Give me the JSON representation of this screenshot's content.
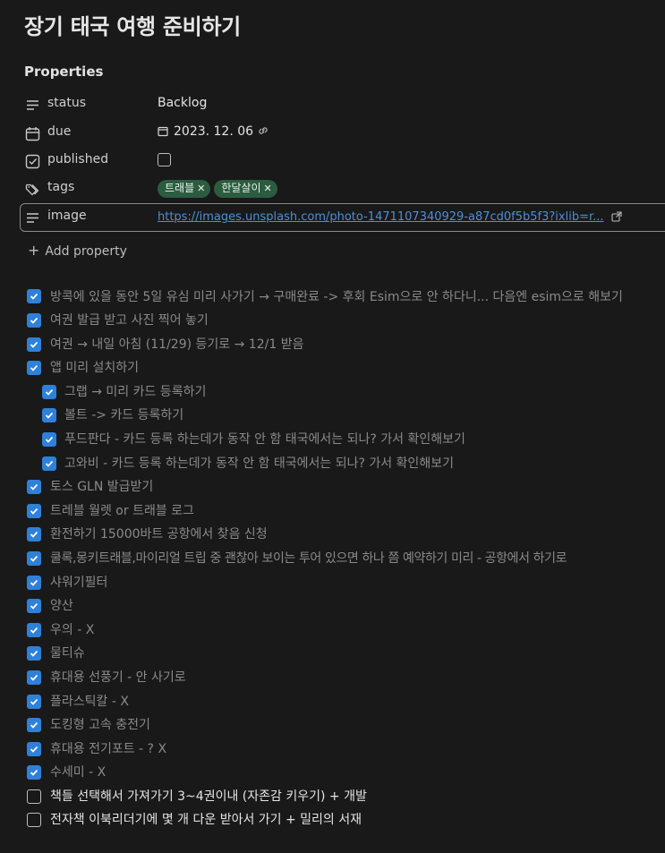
{
  "page": {
    "title": "장기 태국 여행 준비하기",
    "properties_heading": "Properties"
  },
  "properties": {
    "status": {
      "name": "status",
      "value": "Backlog"
    },
    "due": {
      "name": "due",
      "value": "2023. 12. 06"
    },
    "published": {
      "name": "published",
      "checked": false
    },
    "tags": {
      "name": "tags",
      "items": [
        "트래블",
        "한달살이"
      ],
      "color": "#2b5c3f"
    },
    "image": {
      "name": "image",
      "value": "https://images.unsplash.com/photo-1471107340929-a87cd0f5b5f3?ixlib=r..."
    },
    "add_property_label": "Add property"
  },
  "checklist": [
    {
      "text": "방콕에 있을 동안 5일 유심 미리 사가기 → 구매완료 -> 후회 Esim으로 안 하다니... 다음엔 esim으로 해보기",
      "checked": true,
      "indent": 0
    },
    {
      "text": "여권 발급 받고 사진 찍어 놓기",
      "checked": true,
      "indent": 0
    },
    {
      "text": "여권 → 내일 아침 (11/29) 등기로 → 12/1 받음",
      "checked": true,
      "indent": 0
    },
    {
      "text": "앱 미리 설치하기",
      "checked": true,
      "indent": 0
    },
    {
      "text": "그랩 → 미리 카드 등록하기",
      "checked": true,
      "indent": 1
    },
    {
      "text": "볼트 -> 카드 등록하기",
      "checked": true,
      "indent": 1
    },
    {
      "text": "푸드판다 - 카드 등록 하는데가 동작 안 함 태국에서는 되나? 가서 확인해보기",
      "checked": true,
      "indent": 1
    },
    {
      "text": "고와비 - 카드 등록 하는데가 동작 안 함 태국에서는 되나? 가서 확인해보기",
      "checked": true,
      "indent": 1
    },
    {
      "text": "토스 GLN 발급받기",
      "checked": true,
      "indent": 0
    },
    {
      "text": "트레블 월렛 or 트래블 로그",
      "checked": true,
      "indent": 0
    },
    {
      "text": "환전하기 15000바트 공항에서 찾음 신청",
      "checked": true,
      "indent": 0
    },
    {
      "text": "쿨록,몽키트래블,마이리얼 트립 중 괜찮아 보이는 투어 있으면 하나 쯤 예약하기 미리 - 공항에서 하기로",
      "checked": true,
      "indent": 0
    },
    {
      "text": "샤워기필터",
      "checked": true,
      "indent": 0
    },
    {
      "text": "양산",
      "checked": true,
      "indent": 0
    },
    {
      "text": "우의 - X",
      "checked": true,
      "indent": 0
    },
    {
      "text": "물티슈",
      "checked": true,
      "indent": 0
    },
    {
      "text": "휴대용 선풍기 - 안 사기로",
      "checked": true,
      "indent": 0
    },
    {
      "text": "플라스틱칼 - X",
      "checked": true,
      "indent": 0
    },
    {
      "text": "도킹형 고속 충전기",
      "checked": true,
      "indent": 0
    },
    {
      "text": "휴대용 전기포트 - ? X",
      "checked": true,
      "indent": 0
    },
    {
      "text": "수세미 - X",
      "checked": true,
      "indent": 0
    },
    {
      "text": "책들 선택해서 가져가기 3~4권이내 (자존감 키우기) + 개발",
      "checked": false,
      "indent": 0
    },
    {
      "text": "전자책 이북리더기에 몇 개 다운 받아서 가기 + 밀리의 서재",
      "checked": false,
      "indent": 0
    }
  ],
  "colors": {
    "background": "#191919",
    "checkbox_checked": "#2f80d8",
    "link": "#4a90d9"
  }
}
